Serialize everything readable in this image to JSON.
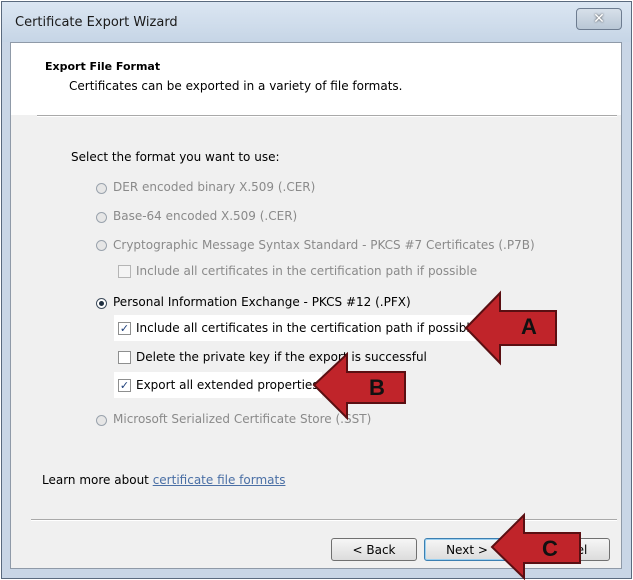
{
  "window": {
    "title": "Certificate Export Wizard"
  },
  "header": {
    "title": "Export File Format",
    "subtitle": "Certificates can be exported in a variety of file formats."
  },
  "prompt": "Select the format you want to use:",
  "options": {
    "der": "DER encoded binary X.509 (.CER)",
    "base64": "Base-64 encoded X.509 (.CER)",
    "pkcs7": "Cryptographic Message Syntax Standard - PKCS #7 Certificates (.P7B)",
    "pkcs7_include": "Include all certificates in the certification path if possible",
    "pfx": "Personal Information Exchange - PKCS #12 (.PFX)",
    "pfx_include": "Include all certificates in the certification path if possible",
    "pfx_delete": "Delete the private key if the export is successful",
    "pfx_extended": "Export all extended properties",
    "sst": "Microsoft Serialized Certificate Store (.SST)"
  },
  "learn_more": {
    "prefix": "Learn more about ",
    "link": "certificate file formats"
  },
  "buttons": {
    "back": "< Back",
    "next": "Next >",
    "cancel": "Cancel"
  },
  "callouts": {
    "a": "A",
    "b": "B",
    "c": "C"
  },
  "colors": {
    "callout_arrow": "#c0242a",
    "callout_box": "#e6000a"
  }
}
